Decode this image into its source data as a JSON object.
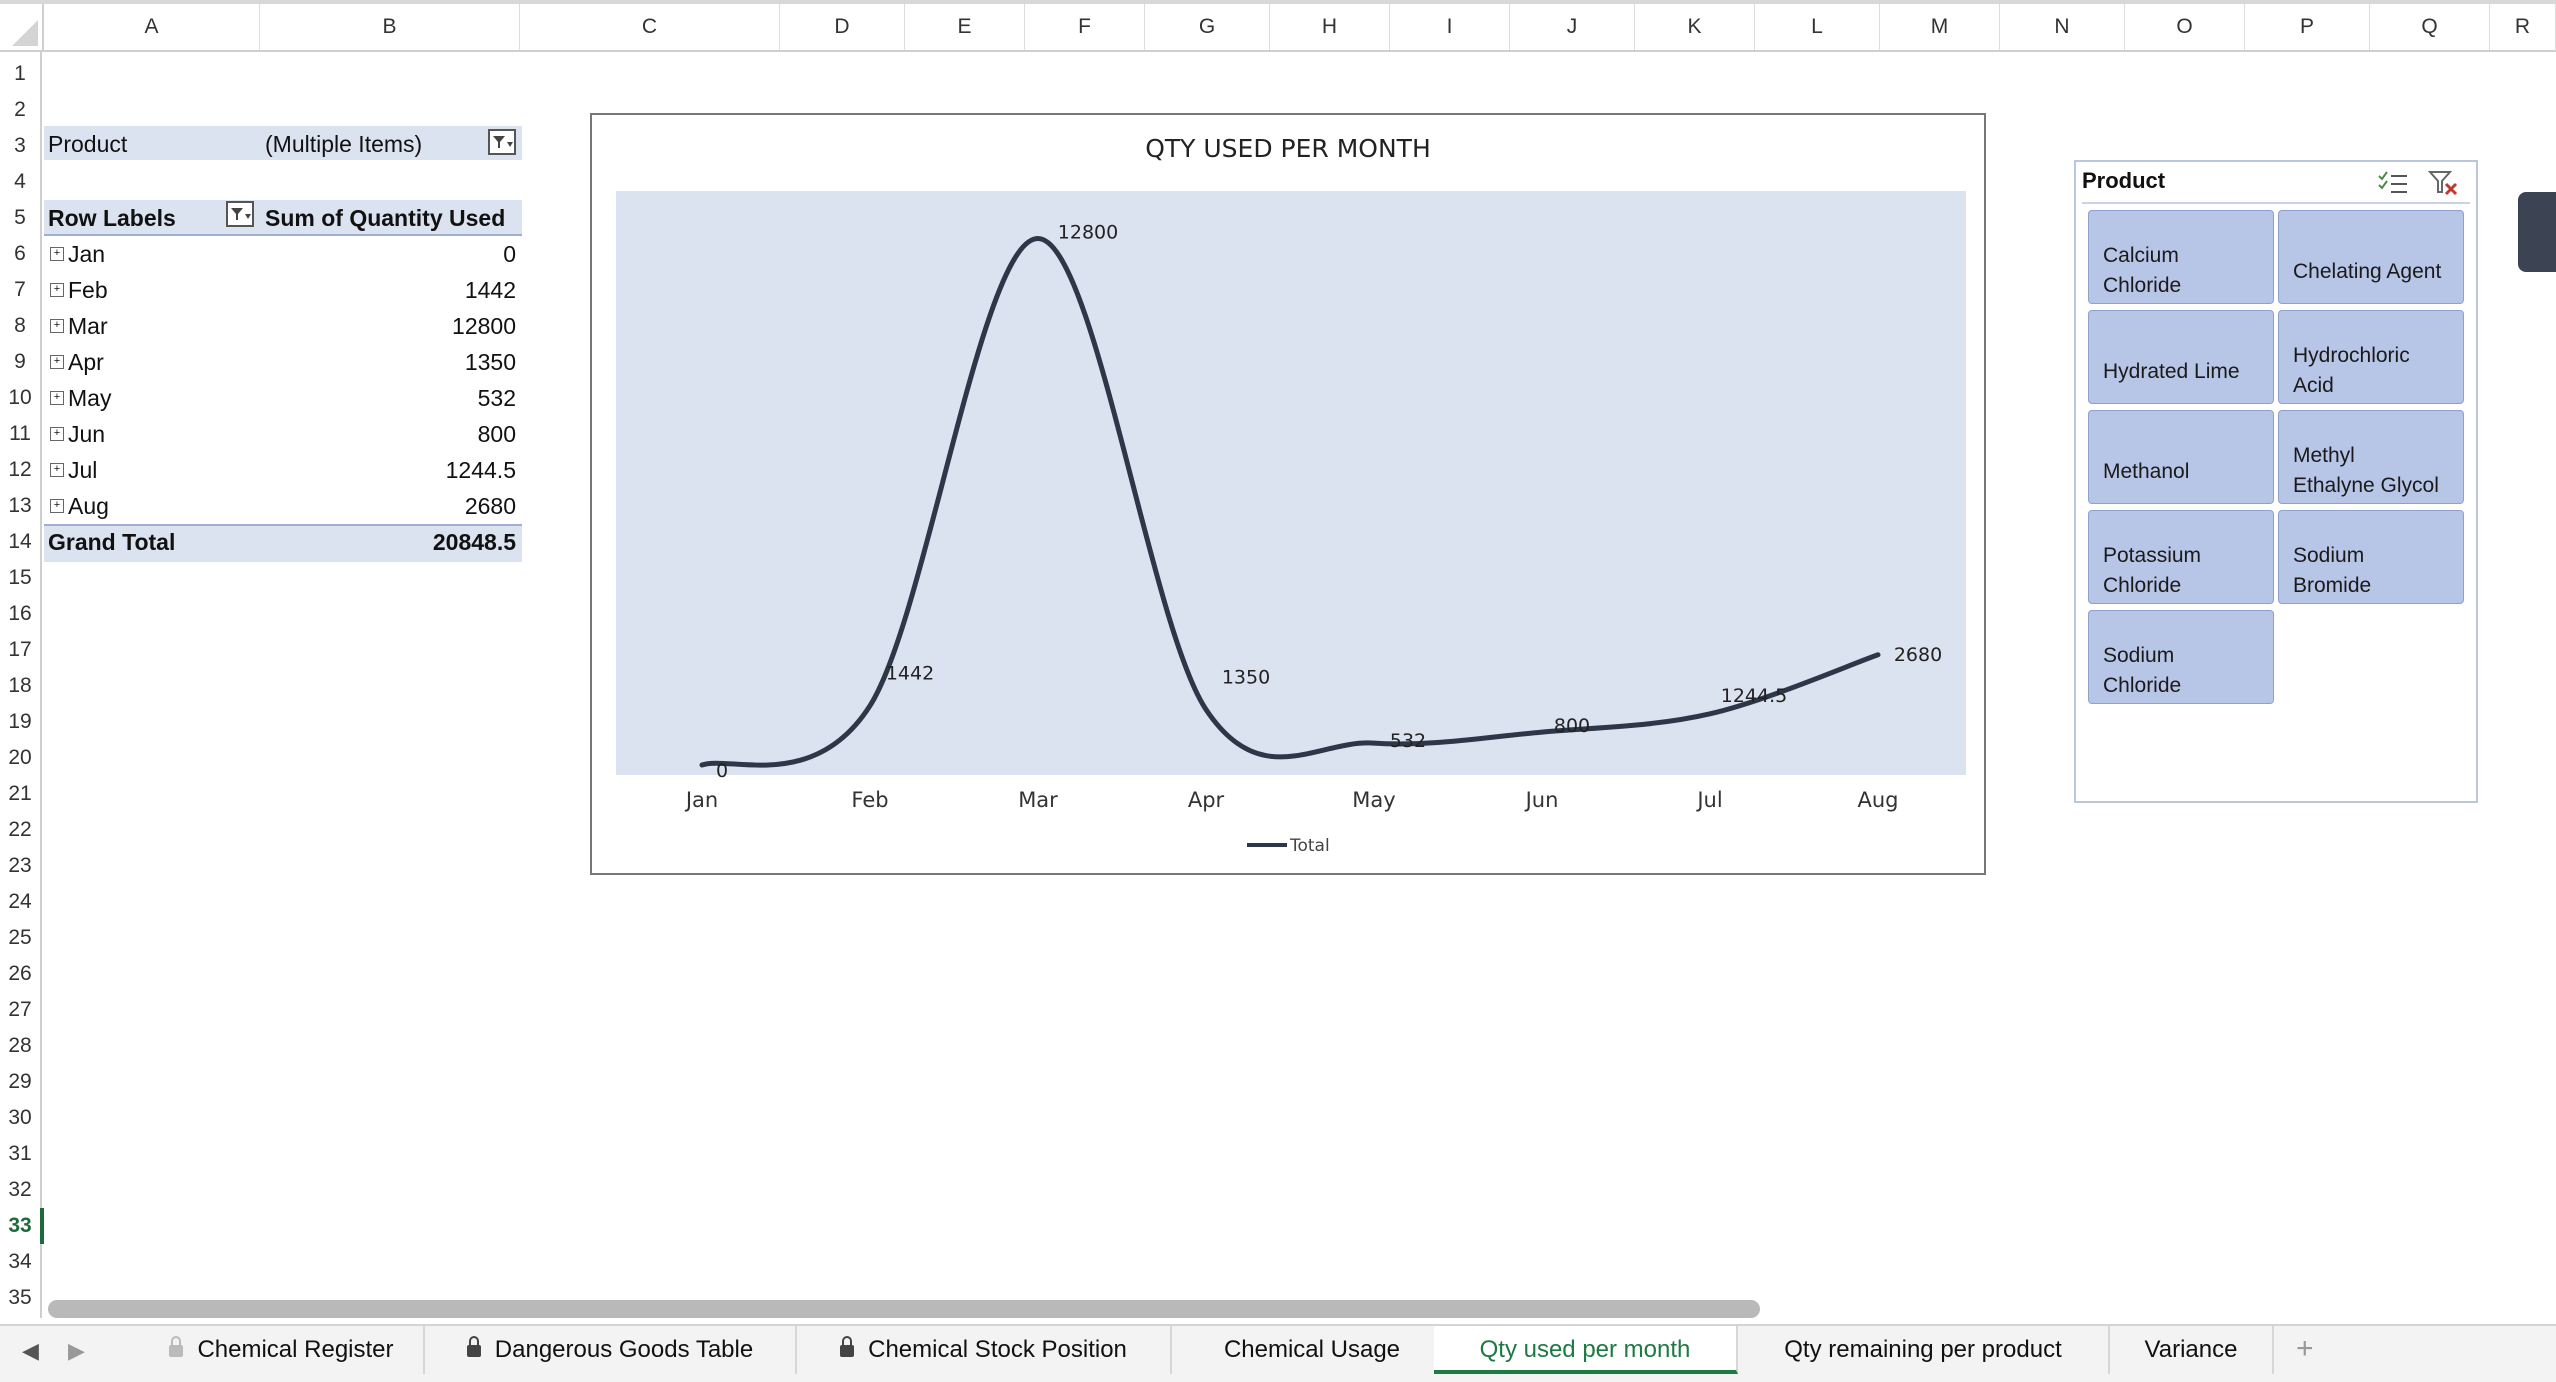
{
  "columns": [
    "A",
    "B",
    "C",
    "D",
    "E",
    "F",
    "G",
    "H",
    "I",
    "J",
    "K",
    "L",
    "M",
    "N",
    "O",
    "P",
    "Q",
    "R"
  ],
  "rows": [
    "1",
    "2",
    "3",
    "4",
    "5",
    "6",
    "7",
    "8",
    "9",
    "10",
    "11",
    "12",
    "13",
    "14",
    "15",
    "16",
    "17",
    "18",
    "19",
    "20",
    "21",
    "22",
    "23",
    "24",
    "25",
    "26",
    "27",
    "28",
    "29",
    "30",
    "31",
    "32",
    "33",
    "34",
    "35"
  ],
  "active_row": "33",
  "pivot": {
    "filter_label": "Product",
    "filter_value": "(Multiple Items)",
    "row_labels_header": "Row Labels",
    "sum_header": "Sum of Quantity Used",
    "rows": [
      {
        "label": "Jan",
        "value": "0"
      },
      {
        "label": "Feb",
        "value": "1442"
      },
      {
        "label": "Mar",
        "value": "12800"
      },
      {
        "label": "Apr",
        "value": "1350"
      },
      {
        "label": "May",
        "value": "532"
      },
      {
        "label": "Jun",
        "value": "800"
      },
      {
        "label": "Jul",
        "value": "1244.5"
      },
      {
        "label": "Aug",
        "value": "2680"
      }
    ],
    "grand_total_label": "Grand Total",
    "grand_total_value": "20848.5",
    "expand_glyph": "+"
  },
  "chart_data": {
    "type": "line",
    "title": "QTY USED PER MONTH",
    "categories": [
      "Jan",
      "Feb",
      "Mar",
      "Apr",
      "May",
      "Jun",
      "Jul",
      "Aug"
    ],
    "series": [
      {
        "name": "Total",
        "values": [
          0,
          1442,
          12800,
          1350,
          532,
          800,
          1244.5,
          2680
        ]
      }
    ],
    "data_labels": [
      "0",
      "1442",
      "12800",
      "1350",
      "532",
      "800",
      "1244.5",
      "2680"
    ],
    "ylim": [
      0,
      13000
    ],
    "legend_position": "bottom",
    "plot_background": "#dce3f0",
    "line_color": "#2d3748",
    "smooth": true
  },
  "slicer": {
    "title": "Product",
    "icons": [
      "multi-select-icon",
      "clear-filter-icon"
    ],
    "items": [
      "Calcium Chloride",
      "Chelating Agent",
      "Hydrated Lime",
      "Hydrochloric Acid",
      "Methanol",
      "Methyl Ethalyne Glycol",
      "Potassium Chloride",
      "Sodium Bromide",
      "Sodium Chloride"
    ],
    "item_lines": [
      [
        "Calcium",
        "Chloride"
      ],
      [
        "Chelating Agent",
        ""
      ],
      [
        "Hydrated Lime",
        ""
      ],
      [
        "Hydrochloric",
        "Acid"
      ],
      [
        "Methanol",
        ""
      ],
      [
        "Methyl",
        "Ethalyne Glycol"
      ],
      [
        "Potassium",
        "Chloride"
      ],
      [
        "Sodium",
        "Bromide"
      ],
      [
        "Sodium",
        "Chloride"
      ]
    ],
    "button_color": "#b7c5e7"
  },
  "tabs": [
    {
      "label": "Chemical Register",
      "locked": true
    },
    {
      "label": "Dangerous Goods Table",
      "locked": true
    },
    {
      "label": "Chemical Stock Position",
      "locked": true
    },
    {
      "label": "Chemical Usage",
      "locked": false
    },
    {
      "label": "Qty used per month",
      "locked": false,
      "active": true
    },
    {
      "label": "Qty remaining per product",
      "locked": false
    },
    {
      "label": "Variance",
      "locked": false
    }
  ],
  "tab_nav": {
    "prev": "◀",
    "next": "▶",
    "add": "+"
  },
  "accent_color": "#1d7a43"
}
